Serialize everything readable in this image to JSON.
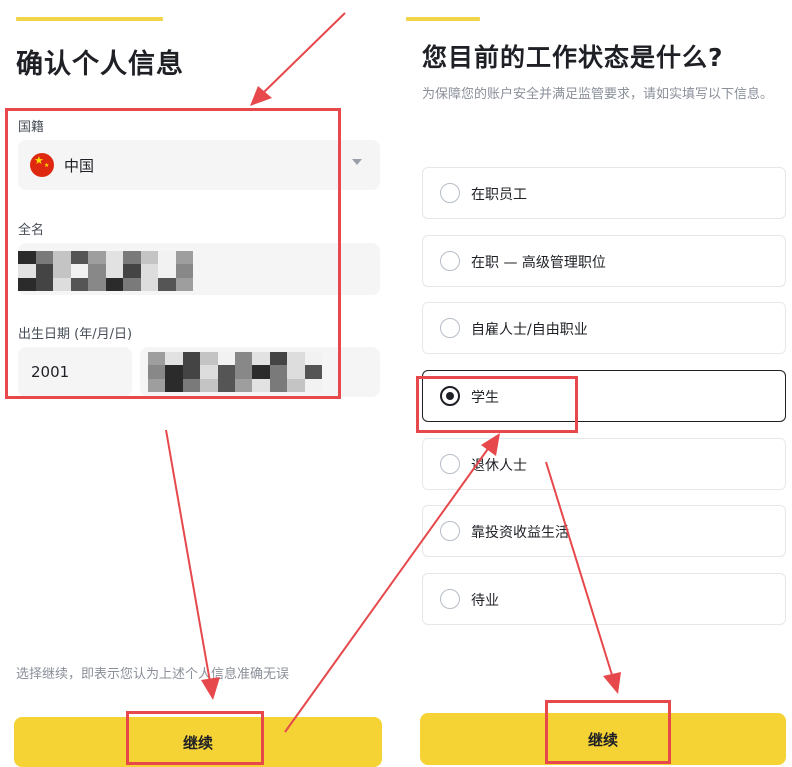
{
  "left": {
    "title": "确认个人信息",
    "nationality": {
      "label": "国籍",
      "value": "中国"
    },
    "fullname": {
      "label": "全名"
    },
    "dob": {
      "label": "出生日期 (年/月/日)",
      "year": "2001"
    },
    "consent": "选择继续，即表示您认为上述个人信息准确无误",
    "continue": "继续"
  },
  "right": {
    "title": "您目前的工作状态是什么?",
    "subtitle": "为保障您的账户安全并满足监管要求，请如实填写以下信息。",
    "options": [
      {
        "label": "在职员工",
        "selected": false
      },
      {
        "label": "在职 — 高级管理职位",
        "selected": false
      },
      {
        "label": "自雇人士/自由职业",
        "selected": false
      },
      {
        "label": "学生",
        "selected": true
      },
      {
        "label": "退休人士",
        "selected": false
      },
      {
        "label": "靠投资收益生活",
        "selected": false
      },
      {
        "label": "待业",
        "selected": false
      }
    ],
    "continue": "继续"
  },
  "colors": {
    "accent": "#f6d335",
    "annotation": "#e6484b",
    "text": "#1e2026",
    "muted": "#8a8f99"
  },
  "icons": {
    "flag": "china-flag-icon",
    "caret": "chevron-down-icon",
    "radio": "radio-icon"
  }
}
